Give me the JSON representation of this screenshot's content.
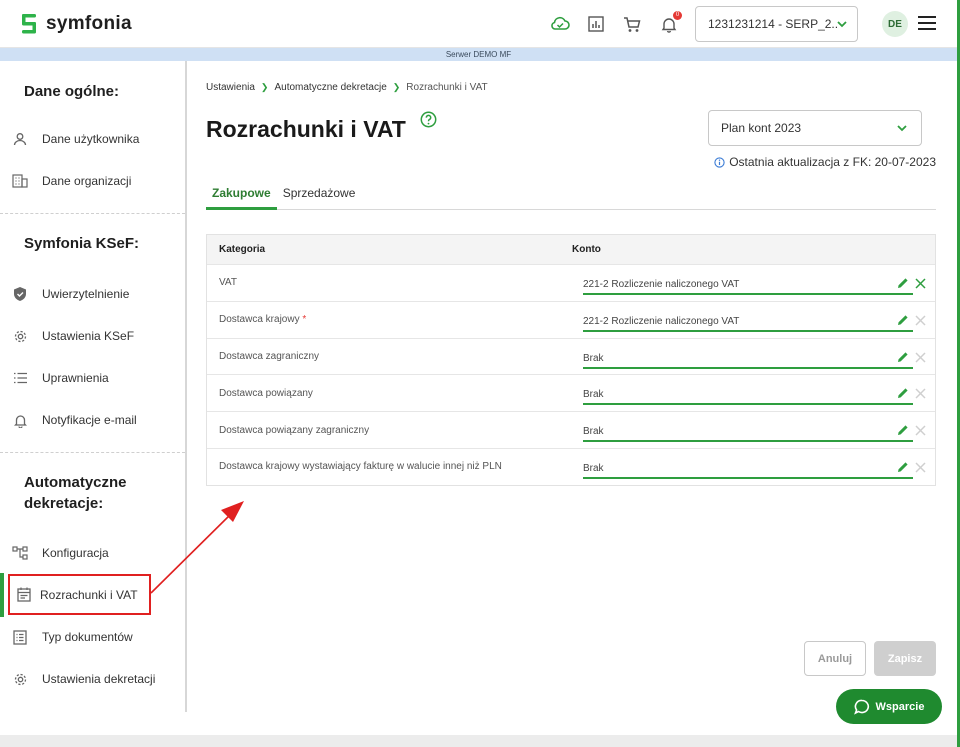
{
  "header": {
    "logo_text": "symfonia",
    "notification_count": "0",
    "company_select": "1231231214 - SERP_2...",
    "avatar_initials": "DE"
  },
  "server_bar": "Serwer DEMO MF",
  "sidebar": {
    "sections": [
      {
        "title": "Dane ogólne:",
        "items": [
          {
            "label": "Dane użytkownika",
            "icon": "user-icon"
          },
          {
            "label": "Dane organizacji",
            "icon": "building-icon"
          }
        ]
      },
      {
        "title": "Symfonia KSeF:",
        "items": [
          {
            "label": "Uwierzytelnienie",
            "icon": "shield-icon"
          },
          {
            "label": "Ustawienia KSeF",
            "icon": "gear-icon"
          },
          {
            "label": "Uprawnienia",
            "icon": "list-icon"
          },
          {
            "label": "Notyfikacje e-mail",
            "icon": "bell-icon"
          }
        ]
      },
      {
        "title": "Automatyczne dekretacje:",
        "items": [
          {
            "label": "Konfiguracja",
            "icon": "flow-icon"
          },
          {
            "label": "Rozrachunki i VAT",
            "icon": "calendar-icon",
            "active": true
          },
          {
            "label": "Typ dokumentów",
            "icon": "document-list-icon"
          },
          {
            "label": "Ustawienia dekretacji",
            "icon": "gear-icon"
          }
        ]
      }
    ]
  },
  "breadcrumb": [
    "Ustawienia",
    "Automatyczne dekretacje",
    "Rozrachunki i VAT"
  ],
  "page_title": "Rozrachunki i VAT",
  "plan_select": "Plan kont 2023",
  "last_update": "Ostatnia aktualizacja z FK: 20-07-2023",
  "tabs": [
    {
      "label": "Zakupowe",
      "active": true
    },
    {
      "label": "Sprzedażowe",
      "active": false
    }
  ],
  "table": {
    "headers": {
      "category": "Kategoria",
      "account": "Konto"
    },
    "rows": [
      {
        "category": "VAT",
        "required": false,
        "account": "221-2 Rozliczenie naliczonego VAT",
        "clear_active": true
      },
      {
        "category": "Dostawca krajowy",
        "required": true,
        "account": "221-2 Rozliczenie naliczonego VAT",
        "clear_active": false
      },
      {
        "category": "Dostawca zagraniczny",
        "required": false,
        "account": "Brak",
        "clear_active": false
      },
      {
        "category": "Dostawca powiązany",
        "required": false,
        "account": "Brak",
        "clear_active": false
      },
      {
        "category": "Dostawca powiązany zagraniczny",
        "required": false,
        "account": "Brak",
        "clear_active": false
      },
      {
        "category": "Dostawca krajowy wystawiający fakturę w walucie innej niż PLN",
        "required": false,
        "account": "Brak",
        "clear_active": false
      }
    ]
  },
  "buttons": {
    "cancel": "Anuluj",
    "save": "Zapisz"
  },
  "support": "Wsparcie",
  "colors": {
    "accent": "#2e9e3f",
    "annotation": "#e02020"
  }
}
